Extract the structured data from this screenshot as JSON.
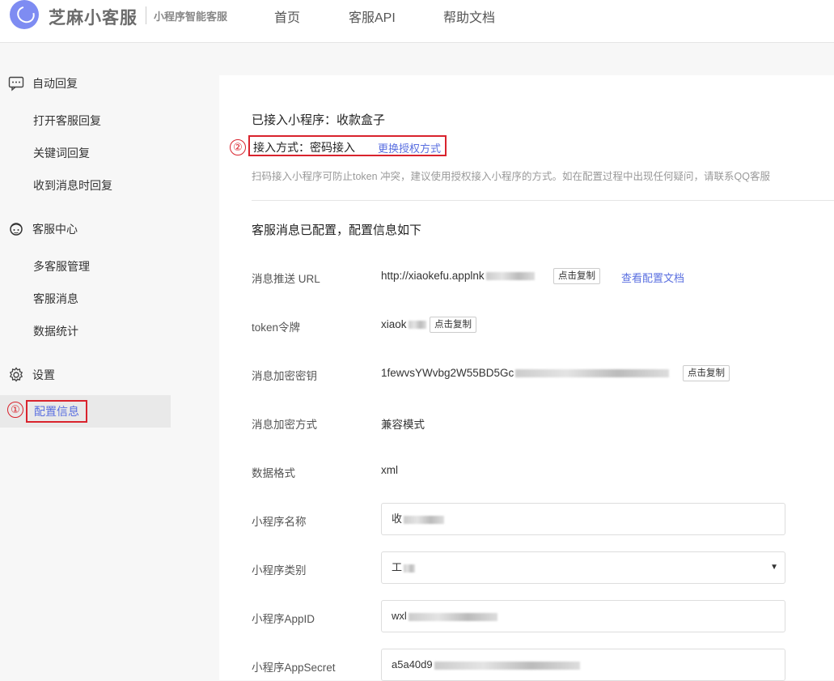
{
  "header": {
    "brand": "芝麻小客服",
    "subtitle": "小程序智能客服",
    "nav": [
      "首页",
      "客服API",
      "帮助文档"
    ]
  },
  "sidebar": {
    "groups": [
      {
        "label": "自动回复",
        "icon": "chat-icon",
        "items": [
          "打开客服回复",
          "关键词回复",
          "收到消息时回复"
        ]
      },
      {
        "label": "客服中心",
        "icon": "agent-avatar-icon",
        "items": [
          "多客服管理",
          "客服消息",
          "数据统计"
        ]
      },
      {
        "label": "设置",
        "icon": "gear-icon",
        "items": [
          "配置信息"
        ]
      }
    ],
    "active_marker": "①"
  },
  "main": {
    "connected_app": "已接入小程序：收款盒子",
    "access_marker": "②",
    "access_method": "接入方式：密码接入",
    "change_auth_link": "更换授权方式",
    "tip": "扫码接入小程序可防止token 冲突，建议使用授权接入小程序的方式。如在配置过程中出现任何疑问，请联系QQ客服",
    "config_title": "客服消息已配置，配置信息如下",
    "copy_label": "点击复制",
    "doc_link": "查看配置文档",
    "rows": {
      "url_label": "消息推送 URL",
      "url_value": "http://xiaokefu.applnk",
      "token_label": "token令牌",
      "token_value": "xiaok",
      "aeskey_label": "消息加密密钥",
      "aeskey_value": "1fewvsYWvbg2W55BD5Gc",
      "encrypt_label": "消息加密方式",
      "encrypt_value": "兼容模式",
      "format_label": "数据格式",
      "format_value": "xml",
      "appname_label": "小程序名称",
      "appname_value": "收",
      "category_label": "小程序类别",
      "category_value": "工",
      "appid_label": "小程序AppID",
      "appid_value": "wxl",
      "secret_label": "小程序AppSecret",
      "secret_value": "a5a40d9"
    }
  },
  "colors": {
    "accent": "#5a6fe0",
    "annotation": "#d9232d",
    "logo": "#7e8cf2"
  }
}
